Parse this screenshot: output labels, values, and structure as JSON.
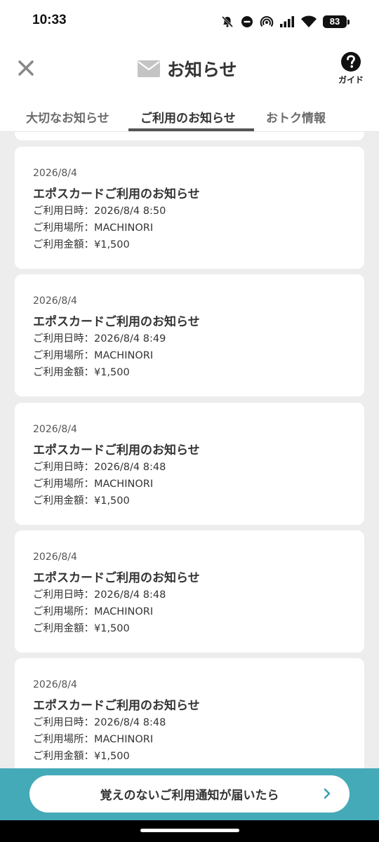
{
  "status_bar": {
    "time": "10:33",
    "battery": "83",
    "icons": [
      "mute-icon",
      "dnd-icon",
      "hotspot-icon",
      "signal-icon",
      "wifi-icon",
      "battery-icon"
    ]
  },
  "header": {
    "close_icon": "close-icon",
    "mail_icon": "mail-icon",
    "title": "お知らせ",
    "guide_icon": "help-icon",
    "guide_label": "ガイド"
  },
  "tabs": [
    {
      "label": "大切なお知らせ",
      "active": false
    },
    {
      "label": "ご利用のお知らせ",
      "active": true
    },
    {
      "label": "おトク情報",
      "active": false
    }
  ],
  "notifications": [
    {
      "date": "2026/8/4",
      "title": "エポスカードご利用のお知らせ",
      "datetime_line": "ご利用日時：2026/8/4 8:50",
      "place_line": "ご利用場所：MACHINORI",
      "amount_line": "ご利用金額：¥1,500"
    },
    {
      "date": "2026/8/4",
      "title": "エポスカードご利用のお知らせ",
      "datetime_line": "ご利用日時：2026/8/4 8:49",
      "place_line": "ご利用場所：MACHINORI",
      "amount_line": "ご利用金額：¥1,500"
    },
    {
      "date": "2026/8/4",
      "title": "エポスカードご利用のお知らせ",
      "datetime_line": "ご利用日時：2026/8/4 8:48",
      "place_line": "ご利用場所：MACHINORI",
      "amount_line": "ご利用金額：¥1,500"
    },
    {
      "date": "2026/8/4",
      "title": "エポスカードご利用のお知らせ",
      "datetime_line": "ご利用日時：2026/8/4 8:48",
      "place_line": "ご利用場所：MACHINORI",
      "amount_line": "ご利用金額：¥1,500"
    },
    {
      "date": "2026/8/4",
      "title": "エポスカードご利用のお知らせ",
      "datetime_line": "ご利用日時：2026/8/4 8:48",
      "place_line": "ご利用場所：MACHINORI",
      "amount_line": "ご利用金額：¥1,500"
    }
  ],
  "bottom_button": {
    "label": "覚えのないご利用通知が届いたら",
    "chevron_icon": "chevron-right-icon"
  },
  "colors": {
    "accent_bar": "#44aab8",
    "chevron": "#3aa0b0",
    "background": "#ededed"
  }
}
